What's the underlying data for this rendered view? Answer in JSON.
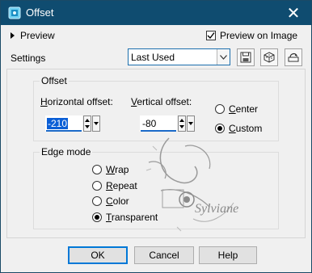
{
  "window": {
    "title": "Offset",
    "close_glyph": "✕"
  },
  "preview": {
    "label": "Preview",
    "preview_on_image_label": "Preview on Image",
    "preview_on_image_checked": true
  },
  "settings": {
    "label": "Settings",
    "selected": "Last Used"
  },
  "icons": [
    "save-icon",
    "reset-icon",
    "delete-preset-icon"
  ],
  "offset": {
    "group_label": "Offset",
    "horizontal": {
      "label_prefix": "H",
      "label_rest": "orizontal offset:",
      "value": "-210"
    },
    "vertical": {
      "label_prefix": "V",
      "label_rest": "ertical offset:",
      "value": "-80"
    },
    "center_label_prefix": "C",
    "center_label_rest": "enter",
    "custom_label_prefix": "C",
    "custom_label_rest": "ustom",
    "selected": "custom"
  },
  "edge_mode": {
    "group_label": "Edge mode",
    "options": [
      {
        "prefix": "W",
        "rest": "rap",
        "selected": false
      },
      {
        "prefix": "R",
        "rest": "epeat",
        "selected": false
      },
      {
        "prefix": "C",
        "rest": "olor",
        "selected": false
      },
      {
        "prefix": "T",
        "rest": "ransparent",
        "selected": true
      }
    ]
  },
  "watermark": {
    "text": "Sylviane"
  },
  "buttons": {
    "ok": "OK",
    "cancel": "Cancel",
    "help": "Help"
  },
  "colors": {
    "titlebar": "#0f4c70",
    "accent": "#0078d7"
  }
}
